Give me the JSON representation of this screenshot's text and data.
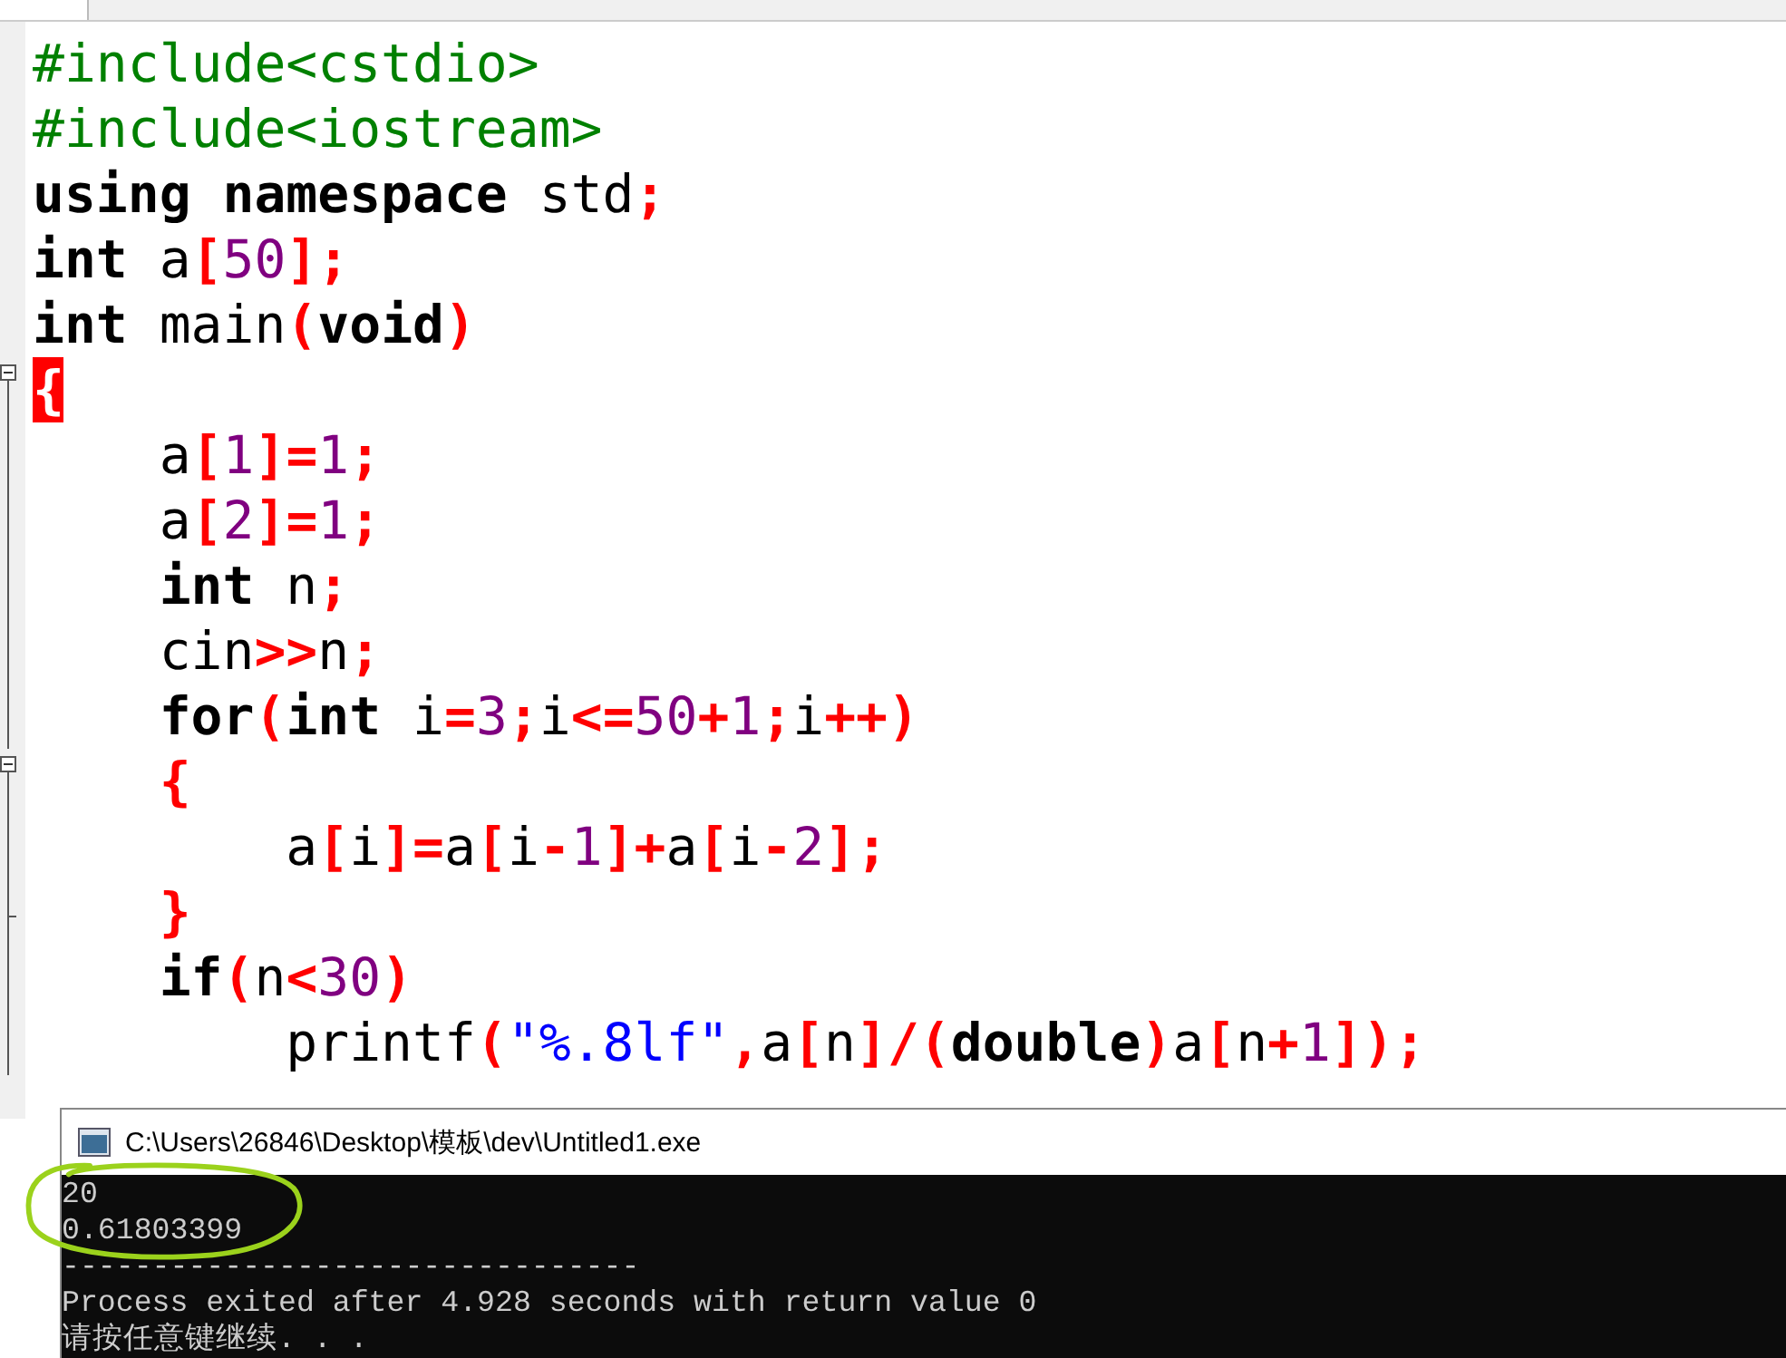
{
  "editor": {
    "lines": [
      {
        "kind": "plain",
        "tokens": [
          {
            "kind": "pre",
            "text": "#include<cstdio>"
          }
        ]
      },
      {
        "kind": "plain",
        "tokens": [
          {
            "kind": "pre",
            "text": "#include<iostream>"
          }
        ]
      },
      {
        "kind": "plain",
        "tokens": [
          {
            "kind": "kw",
            "text": "using namespace"
          },
          {
            "kind": "plain",
            "text": " std"
          },
          {
            "kind": "sym",
            "text": ";"
          }
        ]
      },
      {
        "kind": "plain",
        "tokens": [
          {
            "kind": "kw",
            "text": "int"
          },
          {
            "kind": "plain",
            "text": " a"
          },
          {
            "kind": "sym",
            "text": "["
          },
          {
            "kind": "num",
            "text": "50"
          },
          {
            "kind": "sym",
            "text": "];"
          }
        ]
      },
      {
        "kind": "plain",
        "tokens": [
          {
            "kind": "kw",
            "text": "int"
          },
          {
            "kind": "plain",
            "text": " main"
          },
          {
            "kind": "sym",
            "text": "("
          },
          {
            "kind": "kw",
            "text": "void"
          },
          {
            "kind": "sym",
            "text": ")"
          }
        ]
      },
      {
        "kind": "fold-open",
        "tokens": [
          {
            "kind": "match",
            "text": "{"
          }
        ]
      },
      {
        "kind": "fold-inner",
        "tokens": [
          {
            "kind": "plain",
            "text": "    a"
          },
          {
            "kind": "sym",
            "text": "["
          },
          {
            "kind": "num",
            "text": "1"
          },
          {
            "kind": "sym",
            "text": "]="
          },
          {
            "kind": "num",
            "text": "1"
          },
          {
            "kind": "sym",
            "text": ";"
          }
        ]
      },
      {
        "kind": "fold-inner",
        "tokens": [
          {
            "kind": "plain",
            "text": "    a"
          },
          {
            "kind": "sym",
            "text": "["
          },
          {
            "kind": "num",
            "text": "2"
          },
          {
            "kind": "sym",
            "text": "]="
          },
          {
            "kind": "num",
            "text": "1"
          },
          {
            "kind": "sym",
            "text": ";"
          }
        ]
      },
      {
        "kind": "fold-inner",
        "tokens": [
          {
            "kind": "kw",
            "text": "    int"
          },
          {
            "kind": "plain",
            "text": " n"
          },
          {
            "kind": "sym",
            "text": ";"
          }
        ]
      },
      {
        "kind": "fold-inner",
        "tokens": [
          {
            "kind": "plain",
            "text": "    cin"
          },
          {
            "kind": "sym",
            "text": ">>"
          },
          {
            "kind": "plain",
            "text": "n"
          },
          {
            "kind": "sym",
            "text": ";"
          }
        ]
      },
      {
        "kind": "fold-inner",
        "tokens": [
          {
            "kind": "kw",
            "text": "    for"
          },
          {
            "kind": "sym",
            "text": "("
          },
          {
            "kind": "kw",
            "text": "int"
          },
          {
            "kind": "plain",
            "text": " i"
          },
          {
            "kind": "sym",
            "text": "="
          },
          {
            "kind": "num",
            "text": "3"
          },
          {
            "kind": "sym",
            "text": ";"
          },
          {
            "kind": "plain",
            "text": "i"
          },
          {
            "kind": "sym",
            "text": "<="
          },
          {
            "kind": "num",
            "text": "50"
          },
          {
            "kind": "sym",
            "text": "+"
          },
          {
            "kind": "num",
            "text": "1"
          },
          {
            "kind": "sym",
            "text": ";"
          },
          {
            "kind": "plain",
            "text": "i"
          },
          {
            "kind": "sym",
            "text": "++)"
          }
        ]
      },
      {
        "kind": "fold-open",
        "tokens": [
          {
            "kind": "sym",
            "text": "    {"
          }
        ]
      },
      {
        "kind": "fold-inner",
        "tokens": [
          {
            "kind": "plain",
            "text": "        a"
          },
          {
            "kind": "sym",
            "text": "["
          },
          {
            "kind": "plain",
            "text": "i"
          },
          {
            "kind": "sym",
            "text": "]="
          },
          {
            "kind": "plain",
            "text": "a"
          },
          {
            "kind": "sym",
            "text": "["
          },
          {
            "kind": "plain",
            "text": "i"
          },
          {
            "kind": "sym",
            "text": "-"
          },
          {
            "kind": "num",
            "text": "1"
          },
          {
            "kind": "sym",
            "text": "]+"
          },
          {
            "kind": "plain",
            "text": "a"
          },
          {
            "kind": "sym",
            "text": "["
          },
          {
            "kind": "plain",
            "text": "i"
          },
          {
            "kind": "sym",
            "text": "-"
          },
          {
            "kind": "num",
            "text": "2"
          },
          {
            "kind": "sym",
            "text": "];"
          }
        ]
      },
      {
        "kind": "fold-end",
        "tokens": [
          {
            "kind": "sym",
            "text": "    }"
          }
        ]
      },
      {
        "kind": "fold-inner",
        "tokens": [
          {
            "kind": "kw",
            "text": "    if"
          },
          {
            "kind": "sym",
            "text": "("
          },
          {
            "kind": "plain",
            "text": "n"
          },
          {
            "kind": "sym",
            "text": "<"
          },
          {
            "kind": "num",
            "text": "30"
          },
          {
            "kind": "sym",
            "text": ")"
          }
        ]
      },
      {
        "kind": "fold-inner",
        "tokens": [
          {
            "kind": "plain",
            "text": "        printf"
          },
          {
            "kind": "sym",
            "text": "("
          },
          {
            "kind": "str",
            "text": "\"%.8lf\""
          },
          {
            "kind": "sym",
            "text": ","
          },
          {
            "kind": "plain",
            "text": "a"
          },
          {
            "kind": "sym",
            "text": "["
          },
          {
            "kind": "plain",
            "text": "n"
          },
          {
            "kind": "sym",
            "text": "]/("
          },
          {
            "kind": "kw",
            "text": "double"
          },
          {
            "kind": "sym",
            "text": ")"
          },
          {
            "kind": "plain",
            "text": "a"
          },
          {
            "kind": "sym",
            "text": "["
          },
          {
            "kind": "plain",
            "text": "n"
          },
          {
            "kind": "sym",
            "text": "+"
          },
          {
            "kind": "num",
            "text": "1"
          },
          {
            "kind": "sym",
            "text": "]);"
          }
        ]
      }
    ]
  },
  "console": {
    "title": "C:\\Users\\26846\\Desktop\\模板\\dev\\Untitled1.exe",
    "lines": [
      "20",
      "0.61803399",
      "--------------------------------",
      "Process exited after 4.928 seconds with return value 0",
      "请按任意键继续. . ."
    ]
  }
}
